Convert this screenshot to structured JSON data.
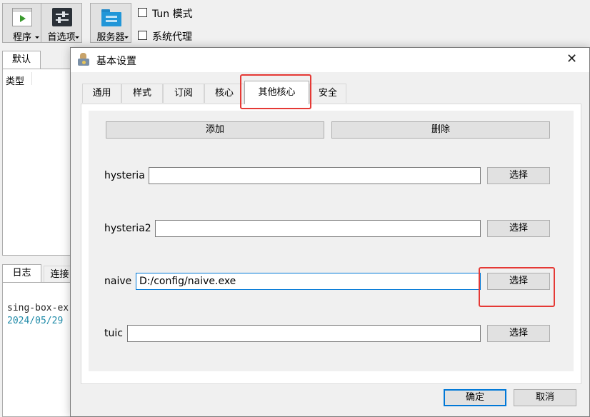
{
  "toolbar": {
    "program_label": "程序",
    "preferences_label": "首选项",
    "servers_label": "服务器",
    "tun_mode_label": "Tun 模式",
    "system_proxy_label": "系统代理"
  },
  "left": {
    "group_tab": "默认",
    "type_header": "类型",
    "log_tab": "日志",
    "conn_tab": "连接",
    "log_line1": "sing-box-ex",
    "log_line2": "2024/05/29"
  },
  "dialog": {
    "title": "基本设置",
    "close_glyph": "✕",
    "tabs": [
      "通用",
      "样式",
      "订阅",
      "核心",
      "其他核心",
      "安全"
    ],
    "add_button": "添加",
    "delete_button": "删除",
    "cores": [
      {
        "name": "hysteria",
        "value": "",
        "button": "选择"
      },
      {
        "name": "hysteria2",
        "value": "",
        "button": "选择"
      },
      {
        "name": "naive",
        "value": "D:/config/naive.exe",
        "button": "选择"
      },
      {
        "name": "tuic",
        "value": "",
        "button": "选择"
      }
    ],
    "ok_button": "确定",
    "cancel_button": "取消"
  },
  "colors": {
    "highlight": "#e53935",
    "focus_border": "#0078d7"
  },
  "icons": {
    "program": "play-icon",
    "preferences": "sliders-icon",
    "servers": "server-folder-icon",
    "dialog": "settings-app-icon"
  }
}
